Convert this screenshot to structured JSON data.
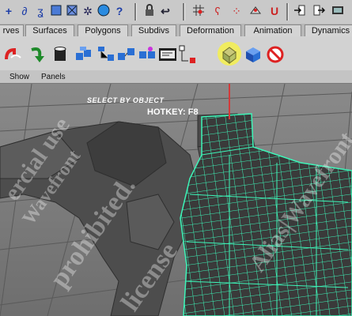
{
  "toolbar": {
    "icons": [
      "plus-icon",
      "lasso-icon",
      "paint-select-icon",
      "select-component-icon",
      "select-hierarchy-icon",
      "scene-gear-icon",
      "sphere-icon",
      "help-icon",
      "lock-icon",
      "snap-grid-icon",
      "snap-curve-icon",
      "snap-point-icon",
      "snap-plane-icon",
      "magnet-icon",
      "input-icon",
      "output-icon",
      "render-icon"
    ]
  },
  "tabs": [
    {
      "label": "rves"
    },
    {
      "label": "Surfaces"
    },
    {
      "label": "Polygons"
    },
    {
      "label": "Subdivs"
    },
    {
      "label": "Deformation"
    },
    {
      "label": "Animation"
    },
    {
      "label": "Dynamics"
    }
  ],
  "menu": [
    {
      "label": "Show"
    },
    {
      "label": "Panels"
    }
  ],
  "viewport": {
    "overlay_title": "SELECT BY OBJECT",
    "overlay_hotkey": "HOTKEY: F8"
  },
  "colors": {
    "wire": "#3df5b8",
    "highlight": "#f0ec60",
    "callout": "#d23a3a"
  }
}
